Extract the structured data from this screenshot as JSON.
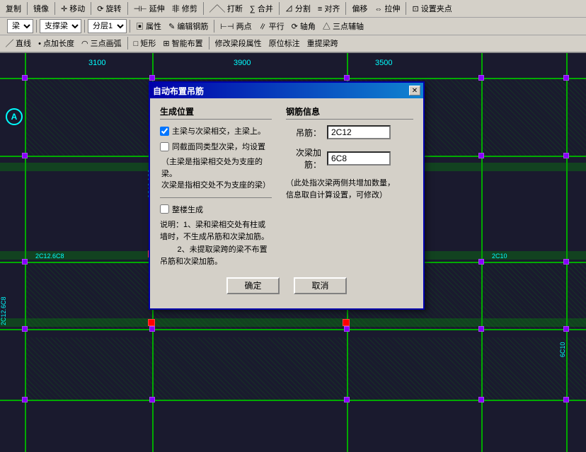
{
  "toolbar": {
    "row1": {
      "buttons": [
        "复制",
        "镜像",
        "移动",
        "旋转",
        "延伸",
        "修剪",
        "打断",
        "合并",
        "分割",
        "对齐",
        "偏移",
        "拉伸",
        "设置夹点"
      ]
    },
    "row2": {
      "select1": "梁",
      "select2": "支撑梁",
      "select3": "分层1",
      "buttons": [
        "属性",
        "编辑钢筋",
        "两点",
        "平行",
        "轴角",
        "三点辅轴"
      ]
    },
    "row3": {
      "buttons": [
        "直线",
        "点加长度",
        "三点画弧",
        "矩形",
        "智能布置",
        "修改梁段属性",
        "原位标注",
        "重提梁跨"
      ]
    }
  },
  "dialog": {
    "title": "自动布置吊筋",
    "sections": {
      "left_title": "生成位置",
      "right_title": "钢筋信息"
    },
    "checkbox1": {
      "checked": true,
      "label": "主梁与次梁相交，主梁上。"
    },
    "checkbox2": {
      "checked": false,
      "label": "同截面同类型次梁，均设置"
    },
    "note1": "（主梁是指梁相交处为支座的梁。\n次梁是指相交处不为支座的梁）",
    "checkbox3": {
      "checked": false,
      "label": "整楼生成"
    },
    "note2": "说明：1、梁和梁相交处有柱或墙时，不生成吊筋和次梁加筋。\n        2、未提取梁跨的梁不布置吊筋和次梁加筋。",
    "rebar1": {
      "label": "吊筋：",
      "value": "2C12"
    },
    "rebar2": {
      "label": "次梁加筋：",
      "value": "6C8"
    },
    "rebar_note": "（此处指次梁两侧共增加数量，\n信息取自计算设置，可修改）",
    "btn_ok": "确定",
    "btn_cancel": "取消"
  },
  "cad": {
    "dim_labels": [
      "3100",
      "3900",
      "3500"
    ],
    "beam_tags": [
      "2C12.6C8",
      "2C12.6C8",
      "2C12.6C8"
    ],
    "circle_label": "A",
    "vertical_tags": [
      "2C12.6C8",
      "6C10"
    ],
    "nodes_count": 20
  },
  "icons": {
    "close": "✕",
    "checkbox_checked": "☑",
    "checkbox_unchecked": "☐"
  }
}
